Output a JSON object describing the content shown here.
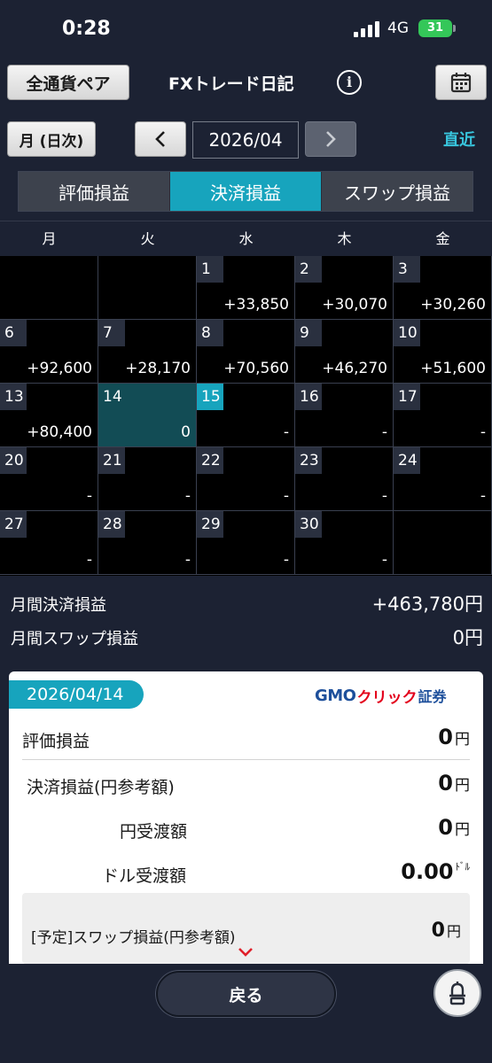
{
  "status": {
    "time": "0:28",
    "network": "4G",
    "battery": "31"
  },
  "header": {
    "pair_button": "全通貨ペア",
    "title": "FXトレード日記",
    "info_glyph": "i"
  },
  "nav": {
    "mode_button": "月 (日次)",
    "month": "2026/04",
    "latest": "直近"
  },
  "tabs": [
    "評価損益",
    "決済損益",
    "スワップ損益"
  ],
  "calendar": {
    "weekdays": [
      "月",
      "火",
      "水",
      "木",
      "金"
    ],
    "cells": [
      {
        "day": "",
        "value": ""
      },
      {
        "day": "",
        "value": ""
      },
      {
        "day": "1",
        "value": "+33,850"
      },
      {
        "day": "2",
        "value": "+30,070"
      },
      {
        "day": "3",
        "value": "+30,260"
      },
      {
        "day": "6",
        "value": "+92,600"
      },
      {
        "day": "7",
        "value": "+28,170"
      },
      {
        "day": "8",
        "value": "+70,560"
      },
      {
        "day": "9",
        "value": "+46,270"
      },
      {
        "day": "10",
        "value": "+51,600"
      },
      {
        "day": "13",
        "value": "+80,400"
      },
      {
        "day": "14",
        "value": "0"
      },
      {
        "day": "15",
        "value": "-"
      },
      {
        "day": "16",
        "value": "-"
      },
      {
        "day": "17",
        "value": "-"
      },
      {
        "day": "20",
        "value": "-"
      },
      {
        "day": "21",
        "value": "-"
      },
      {
        "day": "22",
        "value": "-"
      },
      {
        "day": "23",
        "value": "-"
      },
      {
        "day": "24",
        "value": "-"
      },
      {
        "day": "27",
        "value": "-"
      },
      {
        "day": "28",
        "value": "-"
      },
      {
        "day": "29",
        "value": "-"
      },
      {
        "day": "30",
        "value": "-"
      },
      {
        "day": "",
        "value": ""
      }
    ]
  },
  "totals": {
    "settled_label": "月間決済損益",
    "settled_value": "+463,780円",
    "swap_label": "月間スワップ損益",
    "swap_value": "0円"
  },
  "detail": {
    "date": "2026/04/14",
    "logo_gmo": "GMO",
    "logo_click": "クリック",
    "logo_sec": "証券",
    "rows": [
      {
        "label": "評価損益",
        "value": "0",
        "unit": "円"
      },
      {
        "label": "決済損益(円参考額)",
        "value": "0",
        "unit": "円"
      },
      {
        "label": "円受渡額",
        "value": "0",
        "unit": "円"
      },
      {
        "label": "ドル受渡額",
        "value": "0.00",
        "unit": "ﾄﾞﾙ"
      }
    ],
    "swap_label": "[予定]スワップ損益(円参考額)",
    "swap_value": "0",
    "swap_unit": "円"
  },
  "bottom": {
    "back_button": "戻る"
  }
}
